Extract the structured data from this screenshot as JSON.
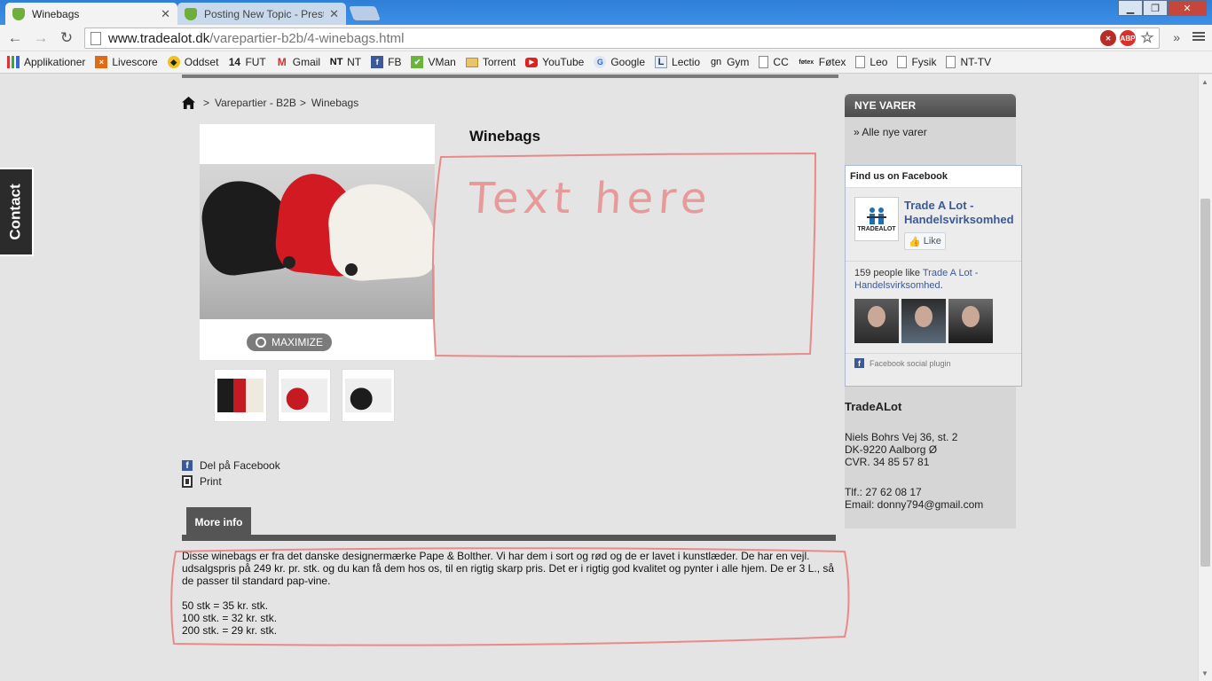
{
  "browser": {
    "tabs": [
      {
        "title": "Winebags",
        "active": true
      },
      {
        "title": "Posting New Topic - Prest",
        "active": false
      }
    ],
    "url_host": "www.tradealot.dk",
    "url_path": "/varepartier-b2b/4-winebags.html",
    "omnibox_icons": [
      "adblock-x-icon",
      "abp-icon",
      "star-icon"
    ],
    "bookmarks": [
      {
        "label": "Applikationer",
        "icon": "apps-grid-icon"
      },
      {
        "label": "Livescore",
        "icon": "livescore-icon"
      },
      {
        "label": "Oddset",
        "icon": "oddset-icon"
      },
      {
        "label": "FUT",
        "icon": "fut-icon"
      },
      {
        "label": "Gmail",
        "icon": "gmail-icon"
      },
      {
        "label": "NT",
        "icon": "nt-icon"
      },
      {
        "label": "FB",
        "icon": "facebook-icon"
      },
      {
        "label": "VMan",
        "icon": "vman-icon"
      },
      {
        "label": "Torrent",
        "icon": "folder-icon"
      },
      {
        "label": "YouTube",
        "icon": "youtube-icon"
      },
      {
        "label": "Google",
        "icon": "google-icon"
      },
      {
        "label": "Lectio",
        "icon": "lectio-icon"
      },
      {
        "label": "Gym",
        "icon": "gym-icon"
      },
      {
        "label": "CC",
        "icon": "page-icon"
      },
      {
        "label": "Føtex",
        "icon": "fotex-icon"
      },
      {
        "label": "Leo",
        "icon": "page-icon"
      },
      {
        "label": "Fysik",
        "icon": "page-icon"
      },
      {
        "label": "NT-TV",
        "icon": "page-icon"
      }
    ]
  },
  "page": {
    "contact_tab": "Contact",
    "breadcrumb": {
      "items": [
        "Varepartier - B2B",
        "Winebags"
      ],
      "separator": ">"
    },
    "product": {
      "title": "Winebags",
      "maximize_label": "MAXIMIZE",
      "annotation_text": "Text here",
      "thumbnails": [
        "thumb-black-red-white",
        "thumb-red-wine",
        "thumb-black-wine"
      ]
    },
    "share": {
      "facebook_label": "Del på Facebook",
      "print_label": "Print"
    },
    "more_info": {
      "tab_label": "More info",
      "description": "Disse winebags er fra det danske designermærke Pape & Bolther. Vi har dem i sort og rød og de er lavet i kunstlæder. De har en vejl. udsalgspris på 249 kr. pr. stk. og du kan få dem hos os, til en rigtig skarp pris. Det er i rigtig god kvalitet og pynter i alle hjem. De er 3 L., så de passer til standard pap-vine.",
      "prices": [
        "50 stk = 35 kr. stk.",
        "100 stk. = 32 kr. stk.",
        "200 stk. = 29 kr. stk."
      ]
    },
    "sidebar": {
      "nye_varer_header": "NYE VARER",
      "nye_varer_link": "» Alle nye varer",
      "facebook": {
        "header": "Find us on Facebook",
        "page_name": "Trade A Lot - Handelsvirksomhed",
        "logo_text": "TRADEALOT",
        "like_label": "Like",
        "count_prefix": "159 people like",
        "count_link": "Trade A Lot - Handelsvirksomhed",
        "count_suffix": ".",
        "plugin_label": "Facebook social plugin"
      },
      "company": {
        "name": "TradeALot",
        "address1": "Niels Bohrs Vej 36, st. 2",
        "address2": "DK-9220 Aalborg Ø",
        "cvr": "CVR. 34 85 57 81",
        "phone": "Tlf.: 27 62 08 17",
        "email": "Email: donny794@gmail.com"
      }
    }
  },
  "colors": {
    "annotation_red": "#e88a8a",
    "fb_blue": "#3b5998",
    "chrome_blue": "#3d8fe6"
  }
}
